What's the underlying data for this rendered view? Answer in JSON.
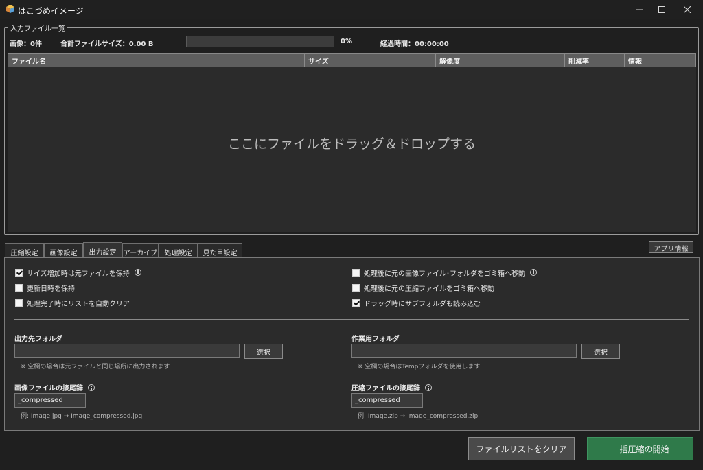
{
  "window": {
    "title": "はこづめイメージ",
    "icon": "app-box-icon",
    "controls": [
      "minimize-icon",
      "maximize-icon",
      "close-icon"
    ]
  },
  "input_group": {
    "label": "入力ファイル一覧",
    "image_count": "画像：0件",
    "total_size": "合計ファイルサイズ：0.00 B",
    "progress_value": 0,
    "progress_text": "0%",
    "elapsed": "経過時間：00:00:00"
  },
  "table": {
    "columns": [
      "ファイル名",
      "サイズ",
      "解像度",
      "削減率",
      "情報"
    ],
    "rows": [],
    "empty_hint": "ここにファイルをドラッグ＆ドロップする"
  },
  "tabs": [
    {
      "label": "圧縮設定",
      "active": false
    },
    {
      "label": "画像設定",
      "active": false
    },
    {
      "label": "出力設定",
      "active": true
    },
    {
      "label": "アーカイブ",
      "active": false
    },
    {
      "label": "処理設定",
      "active": false
    },
    {
      "label": "見た目設定",
      "active": false
    }
  ],
  "app_info_button": "アプリ情報",
  "options_left": [
    {
      "label": "サイズ増加時は元ファイルを保持",
      "checked": true,
      "info": true
    },
    {
      "label": "更新日時を保持",
      "checked": false,
      "info": false
    },
    {
      "label": "処理完了時にリストを自動クリア",
      "checked": false,
      "info": false
    }
  ],
  "options_right": [
    {
      "label": "処理後に元の画像ファイル･フォルダをゴミ箱へ移動",
      "checked": false,
      "info": true
    },
    {
      "label": "処理後に元の圧縮ファイルをゴミ箱へ移動",
      "checked": false,
      "info": false
    },
    {
      "label": "ドラッグ時にサブフォルダも読み込む",
      "checked": true,
      "info": false
    }
  ],
  "output_folder": {
    "label": "出力先フォルダ",
    "value": "",
    "button": "選択",
    "note": "※ 空欄の場合は元ファイルと同じ場所に出力されます"
  },
  "work_folder": {
    "label": "作業用フォルダ",
    "value": "",
    "button": "選択",
    "note": "※ 空欄の場合はTempフォルダを使用します"
  },
  "image_suffix": {
    "label": "画像ファイルの接尾辞",
    "value": "_compressed",
    "example": "例: Image.jpg → Image_compressed.jpg"
  },
  "archive_suffix": {
    "label": "圧縮ファイルの接尾辞",
    "value": "_compressed",
    "example": "例: Image.zip → Image_compressed.zip"
  },
  "actions": {
    "clear_list": "ファイルリストをクリア",
    "start": "一括圧縮の開始"
  },
  "colors": {
    "background": "#1f1f1f",
    "panel": "#2b2b2b",
    "start_button": "#2f7a4a"
  }
}
